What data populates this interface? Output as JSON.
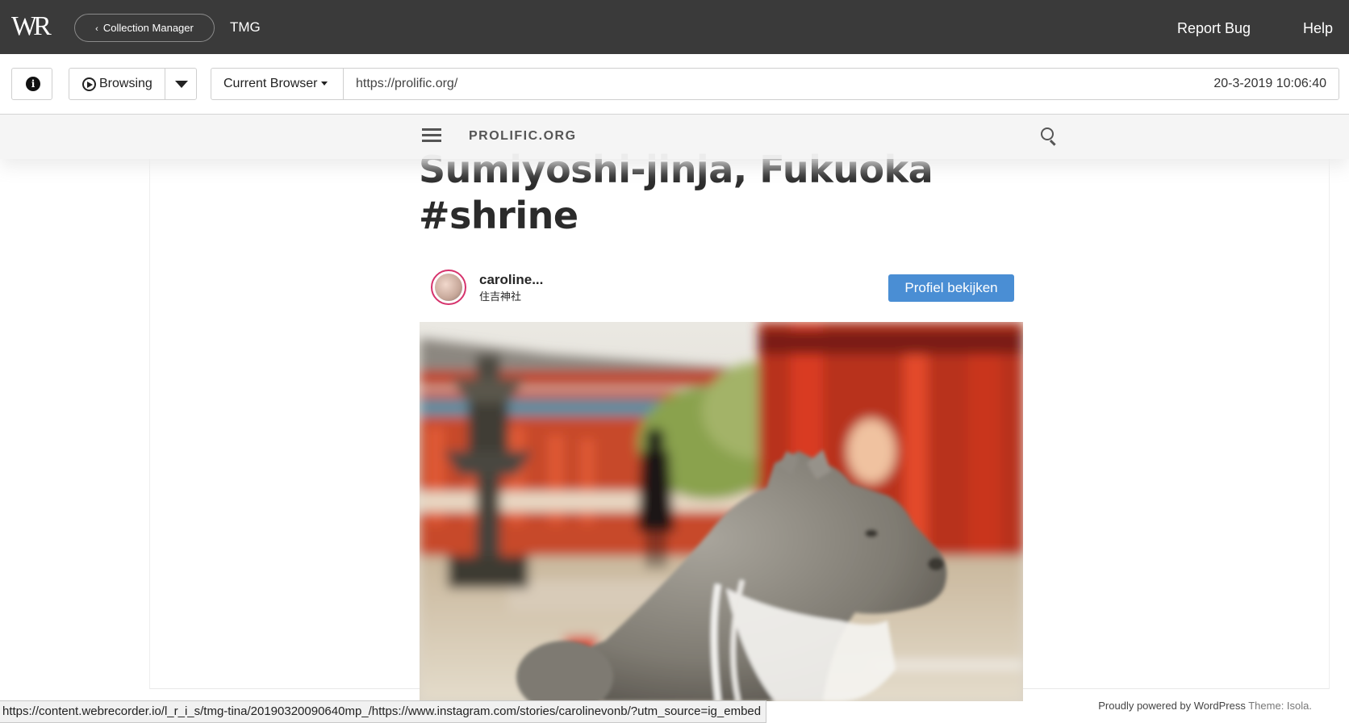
{
  "app": {
    "logo": "WR",
    "collection_manager_label": "Collection Manager",
    "collection_name": "TMG",
    "report_bug": "Report Bug",
    "help": "Help"
  },
  "toolbar": {
    "info_icon": "info-icon",
    "mode_label": "Browsing",
    "browser_label": "Current Browser",
    "url": "https://prolific.org/",
    "timestamp": "20-3-2019 10:06:40"
  },
  "site": {
    "name": "PROLIFIC.ORG",
    "title_line1": "Sumiyoshi-jinja, Fukuoka",
    "title_line2": "#shrine"
  },
  "instagram": {
    "username": "caroline...",
    "location": "住吉神社",
    "follow_label": "Profiel bekijken",
    "button_color": "#4a8ed4"
  },
  "footer": {
    "powered": "Proudly powered by WordPress",
    "theme": "Theme: Isola."
  },
  "status_bar": {
    "link": "https://content.webrecorder.io/l_r_i_s/tmg-tina/20190320090640mp_/https://www.instagram.com/stories/carolinevonb/?utm_source=ig_embed"
  }
}
